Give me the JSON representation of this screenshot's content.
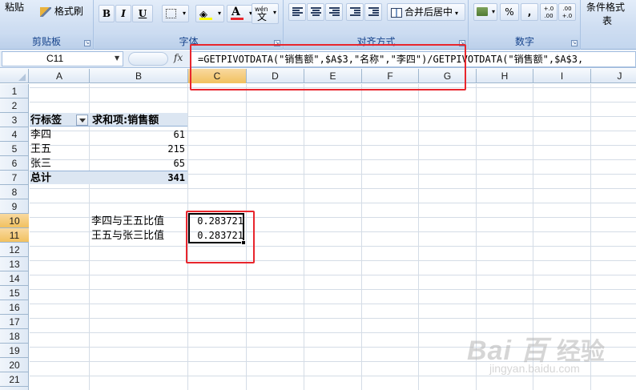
{
  "ribbon": {
    "paste_label": "粘贴",
    "format_painter_label": "格式刷",
    "clipboard_label": "剪贴板",
    "bold": "B",
    "italic": "I",
    "underline": "U",
    "font_color_glyph": "A",
    "phonetic_top": "wén",
    "phonetic_bottom": "文",
    "font_label": "字体",
    "merge_center_label": "合并后居中",
    "alignment_label": "对齐方式",
    "percent": "%",
    "comma": ",",
    "dec_inc": "+.0 .00",
    "dec_dec": ".00 +.0",
    "number_label": "数字",
    "conditional_format_label": "条件格式",
    "styles_partial_label": "表"
  },
  "formula_bar": {
    "name_box": "C11",
    "fx": "fx",
    "formula": "=GETPIVOTDATA(\"销售额\",$A$3,\"名称\",\"李四\")/GETPIVOTDATA(\"销售额\",$A$3,"
  },
  "columns": [
    "A",
    "B",
    "C",
    "D",
    "E",
    "F",
    "G",
    "H",
    "I",
    "J"
  ],
  "active_column": "C",
  "rows": [
    "1",
    "2",
    "3",
    "4",
    "5",
    "6",
    "7",
    "8",
    "9",
    "10",
    "11",
    "12",
    "13",
    "14",
    "15",
    "16",
    "17",
    "18",
    "19",
    "20",
    "21"
  ],
  "active_rows": [
    "10",
    "11"
  ],
  "pivot": {
    "row_label_header": "行标签",
    "value_header": "求和项:销售额",
    "items": [
      {
        "name": "李四",
        "value": "61"
      },
      {
        "name": "王五",
        "value": "215"
      },
      {
        "name": "张三",
        "value": "65"
      }
    ],
    "total_label": "总计",
    "total_value": "341"
  },
  "ratios": [
    {
      "label": "李四与王五比值",
      "value": "0.283721"
    },
    {
      "label": "王五与张三比值",
      "value": "0.283721"
    }
  ],
  "watermark": {
    "logo": "Bai 百",
    "cn": "经验",
    "url": "jingyan.baidu.com"
  },
  "colors": {
    "highlight_box": "#e8262d",
    "pivot_band": "#dce6f2",
    "active_header": "#f1c15f"
  },
  "icons": [
    "paste-icon",
    "format-painter-icon",
    "border-icon",
    "fill-color-icon",
    "font-color-icon",
    "phonetic-icon",
    "align-left-icon",
    "align-center-icon",
    "align-right-icon",
    "decrease-indent-icon",
    "increase-indent-icon",
    "merge-center-icon",
    "currency-icon",
    "percent-icon",
    "comma-icon",
    "increase-decimal-icon",
    "decrease-decimal-icon",
    "dropdown-arrow-icon",
    "filter-dropdown-icon"
  ]
}
